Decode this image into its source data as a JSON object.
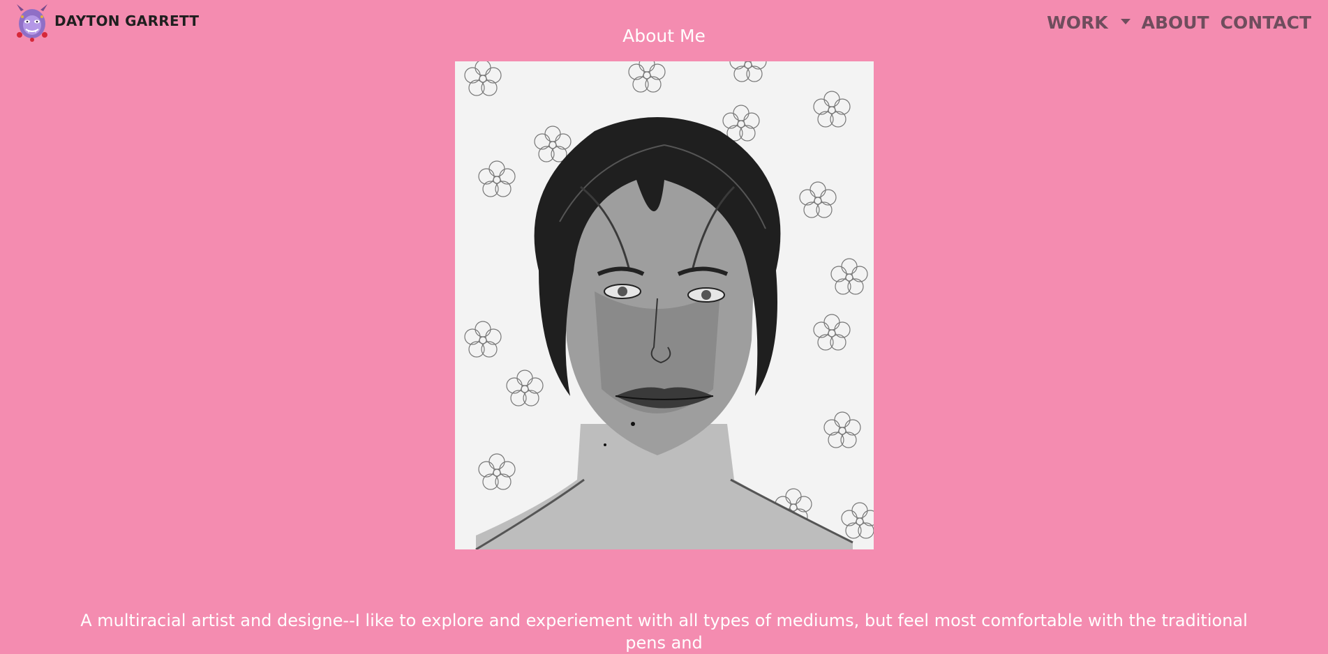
{
  "brand": {
    "name": "DAYTON GARRETT",
    "logo_icon": "demon-mask-logo-icon"
  },
  "nav": {
    "items": [
      {
        "label": "WORK",
        "has_dropdown": true,
        "icon": "caret-down-icon"
      },
      {
        "label": "ABOUT"
      },
      {
        "label": "CONTACT"
      }
    ]
  },
  "page": {
    "title": "About Me"
  },
  "portrait": {
    "subject": "graphite self-portrait drawing with flowers"
  },
  "bio": {
    "text": "A multiracial artist and designe--I like to explore and experiement with all types of mediums, but feel most comfortable with the traditional pens and"
  },
  "colors": {
    "background": "#f48cb0",
    "nav_text": "#6f4d5d",
    "brand_text": "#1f1f1f",
    "body_text": "#ffffff"
  }
}
